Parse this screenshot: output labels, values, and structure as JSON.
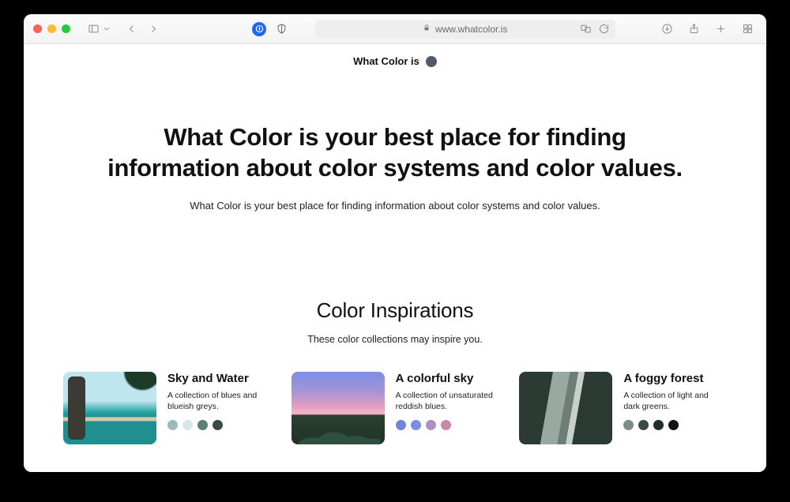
{
  "browser": {
    "url_display": "www.whatcolor.is"
  },
  "brand": {
    "label": "What Color is",
    "dot_color": "#4f5a66"
  },
  "hero": {
    "headline": "What Color is your best place for finding information about color systems and color values.",
    "subline": "What Color is your best place for finding information about color systems and color values."
  },
  "inspirations": {
    "heading": "Color Inspirations",
    "subheading": "These color collections may inspire you.",
    "cards": [
      {
        "title": "Sky and Water",
        "description": "A collection of blues and blueish greys.",
        "swatches": [
          "#9fb8bd",
          "#d7e8e8",
          "#5d7d79",
          "#3b4a44"
        ]
      },
      {
        "title": "A colorful sky",
        "description": "A collection of unsaturated reddish blues.",
        "swatches": [
          "#6e86d6",
          "#7a8fe0",
          "#b08fc4",
          "#c98aa9"
        ]
      },
      {
        "title": "A foggy forest",
        "description": "A collection of light and dark greens.",
        "swatches": [
          "#7e8c86",
          "#3b4a42",
          "#232e28",
          "#10140f"
        ]
      }
    ]
  }
}
